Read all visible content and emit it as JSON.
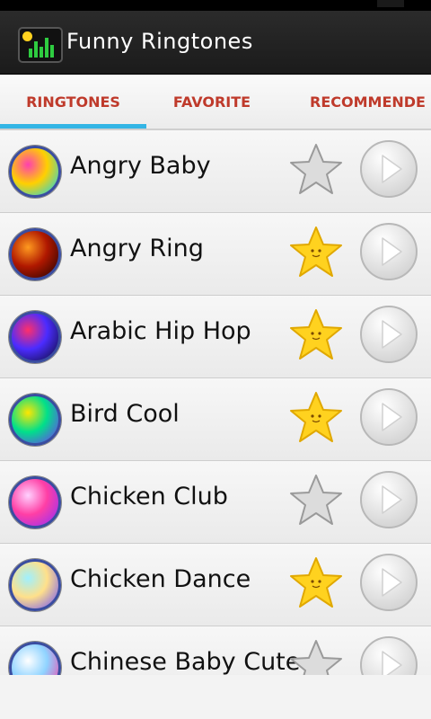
{
  "app": {
    "title": "Funny Ringtones"
  },
  "tabs": [
    {
      "label": "RINGTONES",
      "active": true
    },
    {
      "label": "FAVORITE",
      "active": false
    },
    {
      "label": "RECOMMENDE",
      "active": false
    }
  ],
  "colors": {
    "accent": "#33b5e5",
    "tab_text": "#bf3a2b",
    "star_on": "#ffd21f",
    "star_off": "#dcdcdc"
  },
  "ringtones": [
    {
      "name": "Angry Baby",
      "favorite": false,
      "thumb": [
        "#ff3fb0",
        "#ffd000",
        "#00d6ff"
      ]
    },
    {
      "name": "Angry Ring",
      "favorite": true,
      "thumb": [
        "#ff9a1f",
        "#b01800",
        "#1a0000"
      ]
    },
    {
      "name": "Arabic Hip Hop",
      "favorite": true,
      "thumb": [
        "#ff2f6a",
        "#4b2cff",
        "#0b0b30"
      ]
    },
    {
      "name": "Bird Cool",
      "favorite": true,
      "thumb": [
        "#ffe600",
        "#00e08a",
        "#7a2cff"
      ]
    },
    {
      "name": "Chicken Club",
      "favorite": false,
      "thumb": [
        "#ffd1ff",
        "#ff3fa5",
        "#8a2cff"
      ]
    },
    {
      "name": "Chicken Dance",
      "favorite": true,
      "thumb": [
        "#9ff0ff",
        "#ffe08a",
        "#6a4cff"
      ]
    },
    {
      "name": "Chinese Baby Cute",
      "favorite": false,
      "thumb": [
        "#ffffff",
        "#8fd3ff",
        "#ff2fa0"
      ]
    }
  ]
}
